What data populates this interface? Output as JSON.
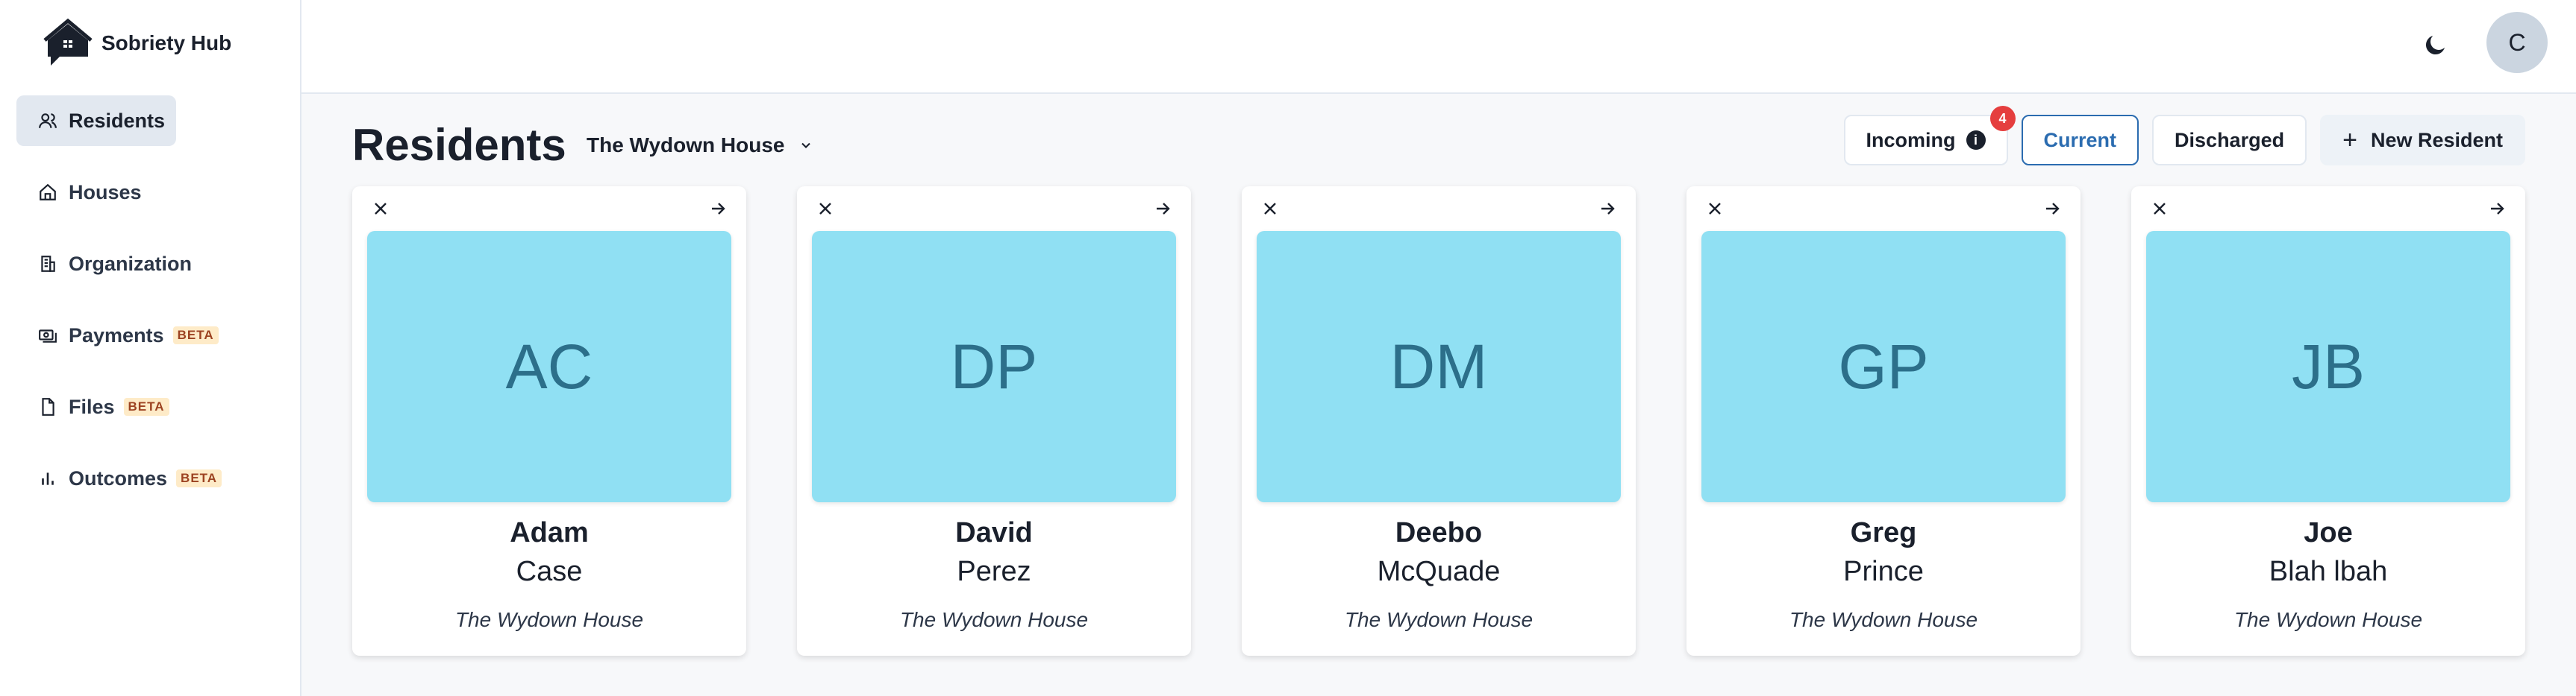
{
  "app": {
    "name": "Sobriety Hub"
  },
  "sidebar": {
    "items": [
      {
        "label": "Residents",
        "icon": "users-icon",
        "active": true
      },
      {
        "label": "Houses",
        "icon": "home-icon"
      },
      {
        "label": "Organization",
        "icon": "building-icon"
      },
      {
        "label": "Payments",
        "icon": "payment-icon",
        "badge": "BETA"
      },
      {
        "label": "Files",
        "icon": "file-icon",
        "badge": "BETA"
      },
      {
        "label": "Outcomes",
        "icon": "bar-chart-icon",
        "badge": "BETA"
      }
    ]
  },
  "topbar": {
    "avatar_initial": "C",
    "theme_icon": "moon-icon"
  },
  "page": {
    "title": "Residents",
    "house_selector": "The Wydown House",
    "tabs": {
      "incoming": "Incoming",
      "incoming_count": "4",
      "current": "Current",
      "discharged": "Discharged"
    },
    "new_button": "New Resident",
    "active_tab": "Current"
  },
  "residents": [
    {
      "initials": "AC",
      "first": "Adam",
      "last": "Case",
      "house": "The Wydown House"
    },
    {
      "initials": "DP",
      "first": "David",
      "last": "Perez",
      "house": "The Wydown House"
    },
    {
      "initials": "DM",
      "first": "Deebo",
      "last": "McQuade",
      "house": "The Wydown House"
    },
    {
      "initials": "GP",
      "first": "Greg",
      "last": "Prince",
      "house": "The Wydown House"
    },
    {
      "initials": "JB",
      "first": "Joe",
      "last": "Blah lbah",
      "house": "The Wydown House"
    }
  ],
  "colors": {
    "accent": "#2b6cb0",
    "photo_bg": "#90e0f3",
    "badge": "#e53e3e"
  }
}
